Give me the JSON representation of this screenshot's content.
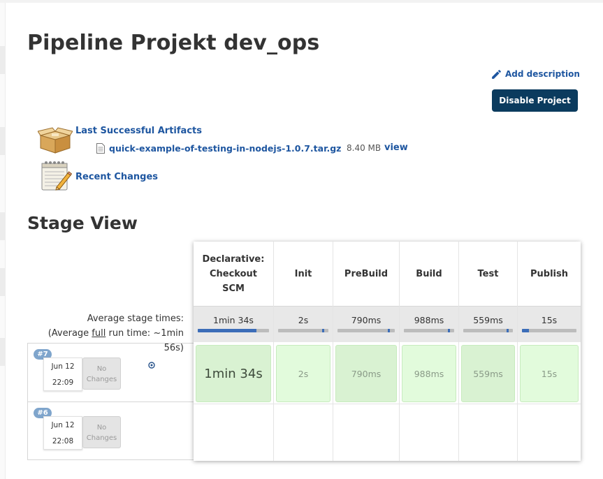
{
  "page": {
    "title": "Pipeline Projekt dev_ops",
    "add_description": "Add description",
    "disable_button": "Disable Project"
  },
  "artifacts": {
    "link": "Last Successful Artifacts",
    "file_name": "quick-example-of-testing-in-nodejs-1.0.7.tar.gz",
    "file_size": "8.40 MB",
    "view": "view"
  },
  "recent_changes": "Recent Changes",
  "stage_view": {
    "title": "Stage View",
    "average_label_1": "Average stage times:",
    "average_label_2a": "(Average ",
    "average_label_2b": "full",
    "average_label_2c": " run time: ~1min",
    "average_label_3": "56s)",
    "stages": [
      {
        "name": "Declarative: Checkout SCM",
        "avg": "1min 34s",
        "progress": 0.82,
        "run7": "1min 34s"
      },
      {
        "name": "Init",
        "avg": "2s",
        "progress": 0.02,
        "run7": "2s"
      },
      {
        "name": "PreBuild",
        "avg": "790ms",
        "progress": 0.01,
        "run7": "790ms"
      },
      {
        "name": "Build",
        "avg": "988ms",
        "progress": 0.01,
        "run7": "988ms"
      },
      {
        "name": "Test",
        "avg": "559ms",
        "progress": 0.01,
        "run7": "559ms"
      },
      {
        "name": "Publish",
        "avg": "15s",
        "progress": 0.13,
        "run7": "15s"
      }
    ],
    "builds": [
      {
        "number": "#7",
        "date": "Jun 12",
        "time": "22:09",
        "changes": "No Changes"
      },
      {
        "number": "#6",
        "date": "Jun 12",
        "time": "22:08",
        "changes": "No Changes"
      }
    ]
  },
  "colors": {
    "link": "#1e56a0",
    "button": "#0b3b5e",
    "success_cell": "#e2fbdc",
    "badge": "#7fa5cc"
  }
}
